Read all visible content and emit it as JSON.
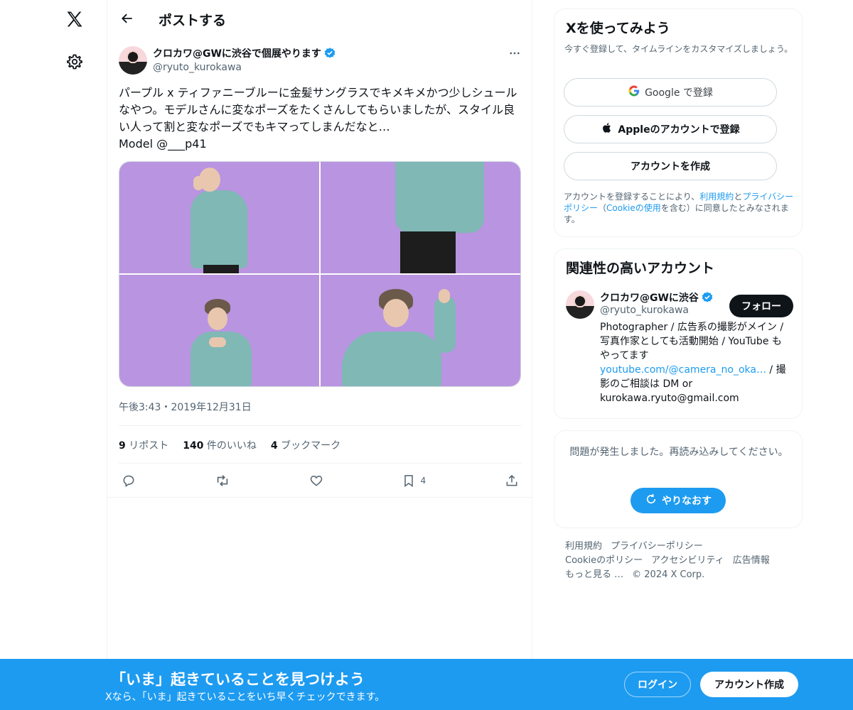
{
  "header": {
    "title": "ポストする"
  },
  "post": {
    "author_name": "クロカワ@GWに渋谷で個展やります",
    "author_handle": "@ryuto_kurokawa",
    "text": "パープル x ティファニーブルーに金髪サングラスでキメキメかつ少しシュールなやつ。モデルさんに変なポーズをたくさんしてもらいましたが、スタイル良い人って割と変なポーズでもキマってしまんだなと…\nModel @___p41",
    "time": "午後3:43・2019年12月31日",
    "stats": {
      "reposts_count": "9",
      "reposts_label": "リポスト",
      "likes_count": "140",
      "likes_label": "件のいいね",
      "bookmarks_count": "4",
      "bookmarks_label": "ブックマーク"
    },
    "bookmark_action_count": "4"
  },
  "signup": {
    "title": "Xを使ってみよう",
    "subtitle": "今すぐ登録して、タイムラインをカスタマイズしましょう。",
    "google_label": "Google で登録",
    "apple_label": "Appleのアカウントで登録",
    "create_label": "アカウントを作成",
    "legal_prefix": "アカウントを登録することにより、",
    "legal_terms": "利用規約",
    "legal_and": "と",
    "legal_privacy": "プライバシーポリシー",
    "legal_open": "（",
    "legal_cookie": "Cookieの使用",
    "legal_suffix": "を含む）に同意したとみなされます。"
  },
  "related": {
    "title": "関連性の高いアカウント",
    "name": "クロカワ@GWに渋谷",
    "handle": "@ryuto_kurokawa",
    "follow_label": "フォロー",
    "bio_1": "Photographer / 広告系の撮影がメイン / 写真作家としても活動開始 / YouTube もやってます ",
    "bio_link": "youtube.com/@camera_no_oka…",
    "bio_2": " / 撮影のご相談は DM or kurokawa.ryuto@gmail.com"
  },
  "error": {
    "message": "問題が発生しました。再読み込みしてください。",
    "retry_label": "やりなおす"
  },
  "footer": {
    "links": [
      "利用規約",
      "プライバシーポリシー",
      "Cookieのポリシー",
      "アクセシビリティ",
      "広告情報",
      "もっと見る …"
    ],
    "copyright": "© 2024 X Corp."
  },
  "banner": {
    "headline": "「いま」起きていることを見つけよう",
    "subline": "Xなら、「いま」起きていることをいち早くチェックできます。",
    "login_label": "ログイン",
    "signup_label": "アカウント作成"
  },
  "colors": {
    "accent": "#1d9bf0",
    "photo_bg": "#b994e0",
    "sweater": "#7fb8b5"
  },
  "icons": [
    "x-logo-icon",
    "settings-gear-icon",
    "back-arrow-icon",
    "verified-badge-icon",
    "more-icon",
    "reply-icon",
    "repost-icon",
    "like-icon",
    "bookmark-icon",
    "share-icon",
    "google-icon",
    "apple-icon",
    "refresh-icon"
  ]
}
